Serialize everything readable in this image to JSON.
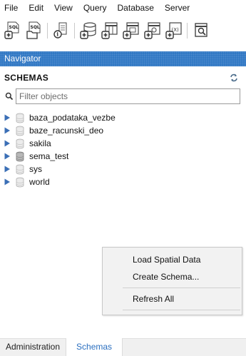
{
  "menubar": {
    "items": [
      {
        "label": "File"
      },
      {
        "label": "Edit"
      },
      {
        "label": "View"
      },
      {
        "label": "Query"
      },
      {
        "label": "Database"
      },
      {
        "label": "Server"
      }
    ]
  },
  "toolbar": {
    "buttons": [
      {
        "icon": "new-sql-tab-icon",
        "text": "SQL"
      },
      {
        "icon": "open-sql-script-icon",
        "text": "SQL"
      },
      {
        "icon": "inspector-icon"
      },
      {
        "icon": "create-schema-icon"
      },
      {
        "icon": "create-table-icon"
      },
      {
        "icon": "create-view-icon"
      },
      {
        "icon": "create-procedure-icon"
      },
      {
        "icon": "create-function-icon",
        "text": "(X)"
      },
      {
        "icon": "search-table-data-icon"
      }
    ]
  },
  "navigator": {
    "title": "Navigator"
  },
  "schemas": {
    "title": "SCHEMAS",
    "filter_placeholder": "Filter objects",
    "items": [
      {
        "label": "baza_podataka_vezbe",
        "default": false
      },
      {
        "label": "baze_racunski_deo",
        "default": false
      },
      {
        "label": "sakila",
        "default": false
      },
      {
        "label": "sema_test",
        "default": true
      },
      {
        "label": "sys",
        "default": false
      },
      {
        "label": "world",
        "default": false
      }
    ]
  },
  "context_menu": {
    "items": [
      {
        "label": "Load Spatial Data"
      },
      {
        "label": "Create Schema..."
      },
      {
        "label": "Refresh All"
      }
    ]
  },
  "bottom_tabs": {
    "items": [
      {
        "label": "Administration",
        "active": false
      },
      {
        "label": "Schemas",
        "active": true
      }
    ]
  },
  "colors": {
    "navigator_header": "#2a73c2",
    "active_tab_text": "#2a6fc0",
    "context_menu_bg": "#f2f2f2"
  }
}
